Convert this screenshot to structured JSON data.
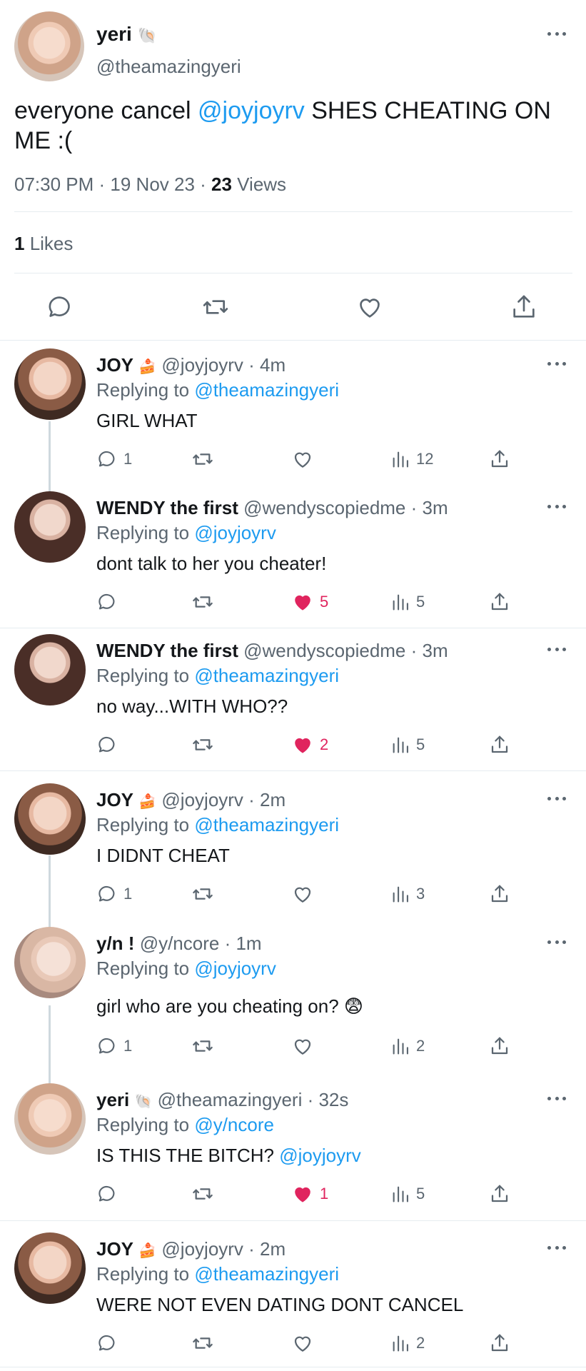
{
  "main_tweet": {
    "name": "yeri",
    "name_emoji": "🐚",
    "handle": "@theamazingyeri",
    "text_before": "everyone cancel ",
    "mention": "@joyjoyrv",
    "text_after": " SHES CHEATING ON ME :(",
    "time": "07:30 PM · 19 Nov 23 · ",
    "views_count": "23",
    "views_label": " Views",
    "likes_count": "1",
    "likes_label": " Likes",
    "icons": [
      "reply-icon",
      "retweet-icon",
      "like-icon",
      "share-icon"
    ]
  },
  "replies": [
    {
      "name": "JOY",
      "emoji": "🍰",
      "meta": "@joyjoyrv · 4m",
      "replying_prefix": "Replying to ",
      "replying_to": "@theamazingyeri",
      "text": "GIRL WHAT",
      "mention": "",
      "reply_count": "1",
      "like_count": "",
      "liked": false,
      "views": "12"
    },
    {
      "name": "WENDY the first",
      "emoji": "",
      "meta": "@wendyscopiedme · 3m",
      "replying_prefix": "Replying to ",
      "replying_to": "@joyjoyrv",
      "text": "dont talk to her you cheater!",
      "mention": "",
      "reply_count": "",
      "like_count": "5",
      "liked": true,
      "views": "5"
    },
    {
      "name": "WENDY the first",
      "emoji": "",
      "meta": "@wendyscopiedme · 3m",
      "replying_prefix": "Replying to ",
      "replying_to": "@theamazingyeri",
      "text": "no way...WITH WHO??",
      "mention": "",
      "reply_count": "",
      "like_count": "2",
      "liked": true,
      "views": "5"
    },
    {
      "name": "JOY",
      "emoji": "🍰",
      "meta": "@joyjoyrv · 2m",
      "replying_prefix": "Replying to ",
      "replying_to": "@theamazingyeri",
      "text": "I DIDNT CHEAT",
      "mention": "",
      "reply_count": "1",
      "like_count": "",
      "liked": false,
      "views": "3"
    },
    {
      "name": "y/n !",
      "emoji": "",
      "meta": "@y/ncore · 1m",
      "replying_prefix": "Replying to ",
      "replying_to": "@joyjoyrv",
      "text": "girl who are you cheating on? 😨",
      "mention": "",
      "reply_count": "1",
      "like_count": "",
      "liked": false,
      "views": "2"
    },
    {
      "name": "yeri",
      "emoji": "🐚",
      "meta": "@theamazingyeri · 32s",
      "replying_prefix": "Replying to ",
      "replying_to": "@y/ncore",
      "text": "IS THIS THE BITCH? ",
      "mention": "@joyjoyrv",
      "reply_count": "",
      "like_count": "1",
      "liked": true,
      "views": "5"
    },
    {
      "name": "JOY",
      "emoji": "🍰",
      "meta": "@joyjoyrv · 2m",
      "replying_prefix": "Replying to ",
      "replying_to": "@theamazingyeri",
      "text": "WERE NOT EVEN DATING DONT CANCEL",
      "mention": "",
      "reply_count": "",
      "like_count": "",
      "liked": false,
      "views": "2"
    }
  ],
  "colors": {
    "link": "#1d9bf0",
    "like": "#e0245e",
    "muted": "#5b6670",
    "divider": "#e6ecf0"
  }
}
